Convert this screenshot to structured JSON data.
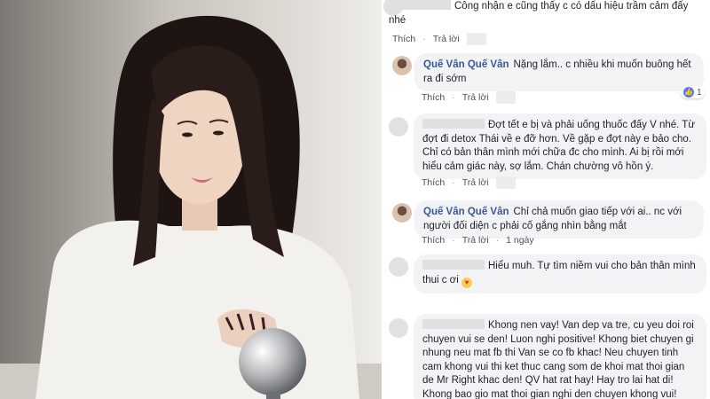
{
  "actions": {
    "like": "Thích",
    "reply": "Trả lời"
  },
  "comments": [
    {
      "author": "",
      "text": "Công nhận e cũng thấy c có dấu hiệu trầm cảm đấy nhé",
      "time": "",
      "likes": ""
    },
    {
      "author": "Quế Vân Quế Vân",
      "text": "Nặng lắm.. c nhiều khi muốn buông hết ra đi sớm",
      "time": "",
      "likes": "1"
    },
    {
      "author": "",
      "text": "Đợt tết e bị và phải uống thuốc đấy V nhé. Từ đợt đi detox Thái về e đỡ hơn. Về gặp e đợt này e bảo cho. Chỉ có bản thân mình mới chữa đc cho mình. Ai bị rồi mới hiểu cảm giác này, sợ lắm. Chán chường vô hồn ý.",
      "time": "",
      "likes": ""
    },
    {
      "author": "Quế Vân Quế Vân",
      "text": "Chỉ chả muốn giao tiếp với ai.. nc với người đối diện c phải cố gắng nhìn bằng mắt",
      "time": "1 ngày",
      "likes": ""
    },
    {
      "author": "",
      "text": "Hiểu muh. Tự tìm niềm vui cho bản thân mình thui c ơi",
      "time": "",
      "likes": ""
    },
    {
      "author": "",
      "text": "Khong nen vay! Van dep va tre, cu yeu doi roi chuyen vui se den! Luon nghi positive! Khong biet chuyen gi nhung neu mat fb thi Van se co fb khac! Neu chuyen tinh cam khong vui thi ket thuc cang som de khoi mat thoi gian de Mr Right khac den! QV hat rat hay! Hay tro lai hat di! Khong bao gio mat thoi gian nghi den chuyen khong vui!",
      "time": "",
      "likes": ""
    }
  ],
  "colors": {
    "name": "#385898",
    "bubble": "#f2f3f5",
    "like": "#4c7ef3"
  },
  "icons": {
    "like_badge": "thumbs-up-icon",
    "reaction": "heart-eyes-emoji-icon"
  }
}
